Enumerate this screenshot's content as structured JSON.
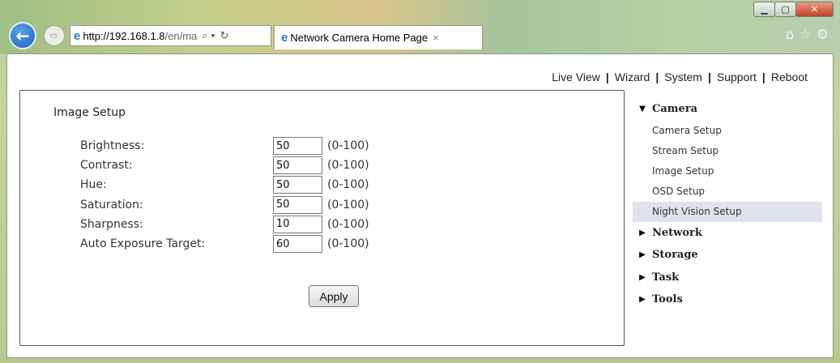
{
  "browser": {
    "url_host": "http://192.168.1.8",
    "url_tail": "/en/ma",
    "tab_title": "Network Camera Home Page",
    "tab_close": "×"
  },
  "topnav": {
    "items": [
      "Live View",
      "Wizard",
      "System",
      "Support",
      "Reboot"
    ]
  },
  "image_setup": {
    "title": "Image Setup",
    "fields": [
      {
        "label": "Brightness:",
        "value": "50",
        "range": "(0-100)"
      },
      {
        "label": "Contrast:",
        "value": "50",
        "range": "(0-100)"
      },
      {
        "label": "Hue:",
        "value": "50",
        "range": "(0-100)"
      },
      {
        "label": "Saturation:",
        "value": "50",
        "range": "(0-100)"
      },
      {
        "label": "Sharpness:",
        "value": "10",
        "range": "(0-100)"
      },
      {
        "label": "Auto Exposure Target:",
        "value": "60",
        "range": "(0-100)"
      }
    ],
    "apply_label": "Apply"
  },
  "menu": {
    "camera": "Camera",
    "camera_items": [
      "Camera Setup",
      "Stream Setup",
      "Image Setup",
      "OSD Setup",
      "Night Vision Setup"
    ],
    "network": "Network",
    "storage": "Storage",
    "task": "Task",
    "tools": "Tools"
  }
}
